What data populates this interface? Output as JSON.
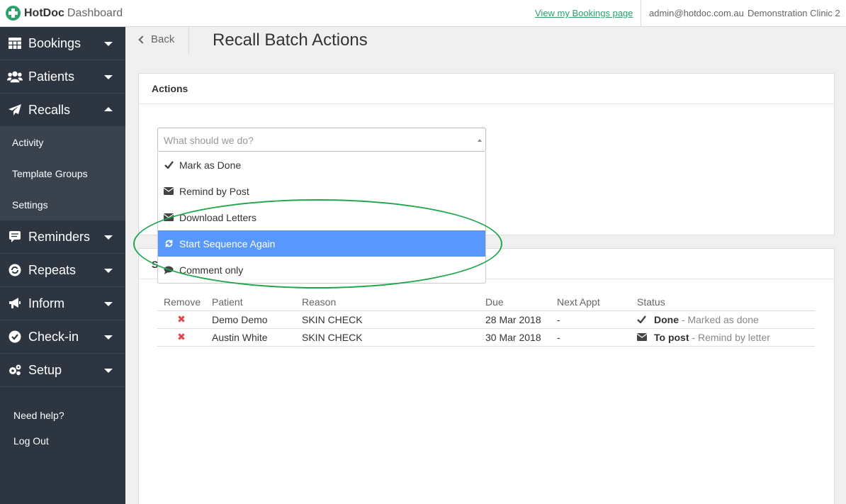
{
  "header": {
    "brand_name": "HotDoc",
    "brand_sub": "Dashboard",
    "bookings_link": "View my Bookings page",
    "user_email": "admin@hotdoc.com.au",
    "clinic_name": "Demonstration Clinic 2"
  },
  "sidebar": {
    "items": [
      {
        "label": "Bookings",
        "icon": "table-icon"
      },
      {
        "label": "Patients",
        "icon": "users-icon"
      },
      {
        "label": "Recalls",
        "icon": "paper-plane-icon"
      },
      {
        "label": "Reminders",
        "icon": "message-icon"
      },
      {
        "label": "Repeats",
        "icon": "refresh-icon"
      },
      {
        "label": "Inform",
        "icon": "bullhorn-icon"
      },
      {
        "label": "Check-in",
        "icon": "check-circle-icon"
      },
      {
        "label": "Setup",
        "icon": "cogs-icon"
      }
    ],
    "recalls_sub": [
      "Activity",
      "Template Groups",
      "Settings"
    ],
    "help_label": "Need help?",
    "logout_label": "Log Out"
  },
  "page": {
    "back_label": "Back",
    "title": "Recall Batch Actions"
  },
  "actions_panel": {
    "heading": "Actions",
    "select_placeholder": "What should we do?",
    "options": [
      {
        "label": "Mark as Done",
        "icon": "check-icon"
      },
      {
        "label": "Remind by Post",
        "icon": "envelope-icon"
      },
      {
        "label": "Download Letters",
        "icon": "envelope-icon"
      },
      {
        "label": "Start Sequence Again",
        "icon": "refresh-icon"
      },
      {
        "label": "Comment only",
        "icon": "comment-icon"
      }
    ],
    "highlighted_option": "Start Sequence Again"
  },
  "list_panel": {
    "heading_partial": "S",
    "columns": [
      "Remove",
      "Patient",
      "Reason",
      "Due",
      "Next Appt",
      "Status"
    ],
    "rows": [
      {
        "patient": "Demo Demo",
        "reason": "SKIN CHECK",
        "due": "28 Mar 2018",
        "next_appt": "-",
        "status_label": "Done",
        "status_detail": " - Marked as done",
        "status_icon": "check-icon"
      },
      {
        "patient": "Austin White",
        "reason": "SKIN CHECK",
        "due": "30 Mar 2018",
        "next_appt": "-",
        "status_label": "To post",
        "status_detail": " - Remind by letter",
        "status_icon": "envelope-icon"
      }
    ]
  },
  "colors": {
    "sidebar_bg": "#2d3540",
    "brand_green": "#2aa36b",
    "highlight_blue": "#5897fb",
    "annotation_green": "#1fa64a",
    "remove_red": "#e0484b"
  }
}
